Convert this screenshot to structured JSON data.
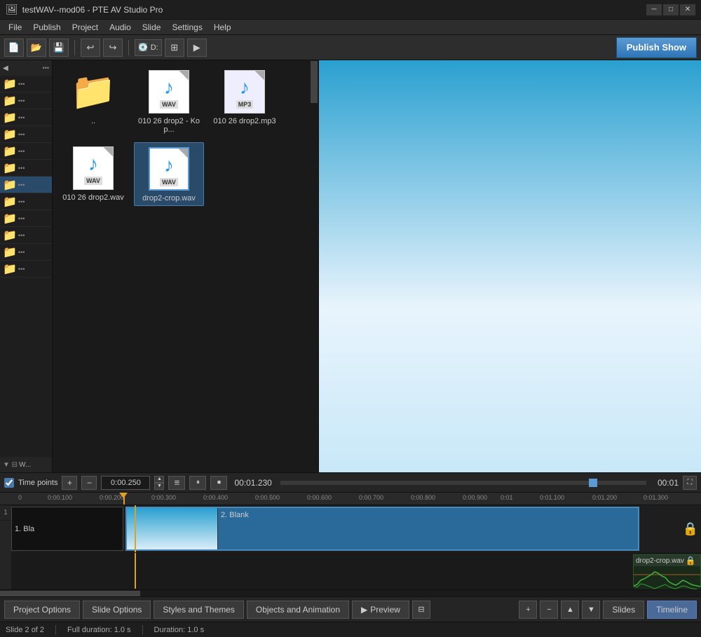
{
  "window": {
    "title": "testWAV--mod06 - PTE AV Studio Pro"
  },
  "menu": {
    "items": [
      "File",
      "Publish",
      "Project",
      "Audio",
      "Slide",
      "Settings",
      "Help"
    ]
  },
  "toolbar": {
    "buttons": [
      "new",
      "open",
      "save",
      "undo",
      "redo",
      "drive",
      "settings"
    ],
    "drive_label": "D:",
    "publish_label": "Publish Show"
  },
  "sidebar": {
    "items": [
      "folder1",
      "folder2",
      "folder3",
      "folder4",
      "folder5",
      "folder6",
      "folder7",
      "folder8",
      "folder9",
      "folder10",
      "folder11",
      "folder12"
    ],
    "bottom_label": "W..."
  },
  "file_browser": {
    "files": [
      {
        "name": "..",
        "type": "folder"
      },
      {
        "name": "010 26 drop2 - Kop...",
        "type": "wav"
      },
      {
        "name": "010 26 drop2.mp3",
        "type": "mp3"
      },
      {
        "name": "010 26 drop2.wav",
        "type": "wav"
      },
      {
        "name": "drop2-crop.wav",
        "type": "wav",
        "selected": true
      }
    ]
  },
  "time_controls": {
    "label": "Time points",
    "current_time": "0:00.250",
    "total_time": "00:01.230",
    "end_time": "00:01"
  },
  "timeline": {
    "ruler_marks": [
      "0:00.100",
      "0:00.200",
      "0:00.300",
      "0:00.400",
      "0:00.500",
      "0:00.600",
      "0:00.700",
      "0:00.800",
      "0:00.900",
      "0:01",
      "0:01.100",
      "0:01.200",
      "0:01.300"
    ],
    "slide1_label": "1. Bla",
    "slide2_label": "2. Blank",
    "audio_label": "drop2-crop.wav",
    "playhead_time": "00:01.230"
  },
  "bottom_tabs": {
    "items": [
      {
        "label": "Project Options",
        "active": false
      },
      {
        "label": "Slide Options",
        "active": false
      },
      {
        "label": "Styles and Themes",
        "active": false
      },
      {
        "label": "Objects and Animation",
        "active": false
      },
      {
        "label": "Preview",
        "active": false
      }
    ],
    "right_tabs": [
      {
        "label": "Slides",
        "active": false
      },
      {
        "label": "Timeline",
        "active": true
      }
    ]
  },
  "status_bar": {
    "slide_info": "Slide 2 of 2",
    "full_duration": "Full duration: 1.0 s",
    "duration": "Duration: 1.0 s"
  },
  "icons": {
    "folder": "📁",
    "note": "♪",
    "play": "▶",
    "pause": "⏸",
    "stop": "⏹",
    "lock": "🔒",
    "plus": "+",
    "minus": "−",
    "preview_icon": "▶",
    "chevron_up": "▲",
    "chevron_down": "▼",
    "hamburger": "≡",
    "fullscreen": "⛶",
    "new": "📄",
    "open": "📂",
    "save": "💾",
    "undo": "↩",
    "redo": "↪"
  }
}
